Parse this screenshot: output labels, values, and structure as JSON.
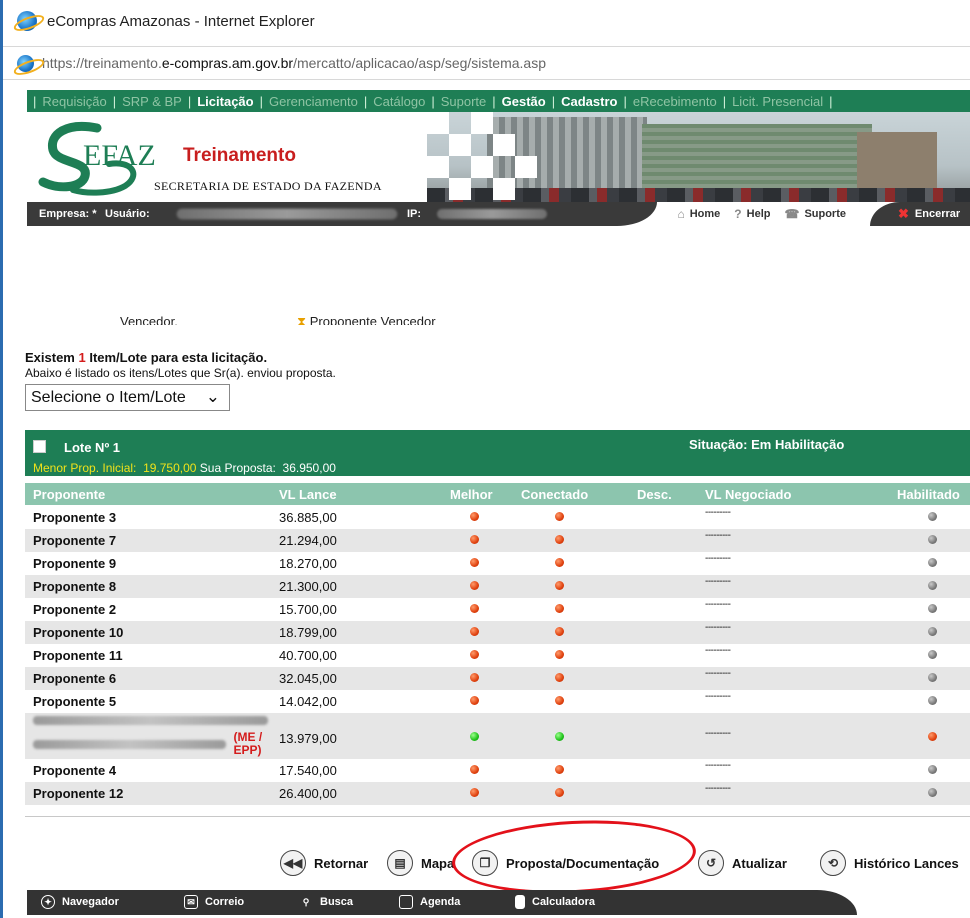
{
  "browser": {
    "title": "eCompras Amazonas - Internet Explorer",
    "url_scheme": "https://",
    "url_sub": "treinamento.",
    "url_host": "e-compras.am.gov.br",
    "url_path": "/mercatto/aplicacao/asp/seg/sistema.asp"
  },
  "topnav": {
    "items": [
      "Requisição",
      "SRP & BP",
      "Licitação",
      "Gerenciamento",
      "Catálogo",
      "Suporte",
      "Gestão",
      "Cadastro",
      "eRecebimento",
      "Licit. Presencial"
    ],
    "active": [
      false,
      false,
      true,
      false,
      false,
      false,
      true,
      true,
      false,
      false
    ]
  },
  "banner": {
    "logo_text": "EFAZ",
    "logo_s": "S",
    "title": "Treinamento",
    "subtitle": "SECRETARIA DE ESTADO DA FAZENDA"
  },
  "infobar": {
    "empresa": "Empresa: *",
    "usuario": "Usuário:",
    "ip": "IP:",
    "home": "Home",
    "help": "Help",
    "suporte": "Suporte",
    "encerrar": "Encerrar"
  },
  "legend": {
    "left": "Vencedor.",
    "right": "Proponente Vencedor"
  },
  "info": {
    "existem_pre": "Existem ",
    "count": "1",
    "existem_post": " Item/Lote para esta licitação.",
    "abaixo": "Abaixo é listado os itens/Lotes que Sr(a). enviou proposta.",
    "select": "Selecione o Item/Lote"
  },
  "lote": {
    "title": "Lote Nº 1",
    "situacao": "Situação: Em Habilitação",
    "menor_label": "Menor Prop. Inicial:",
    "menor_value": "19.750,00",
    "sua_label": "Sua Proposta:",
    "sua_value": "36.950,00"
  },
  "table": {
    "headers": [
      "Proponente",
      "VL Lance",
      "Melhor",
      "Conectado",
      "Desc.",
      "VL Negociado",
      "Habilitado"
    ],
    "rows": [
      {
        "name": "Proponente 3",
        "lance": "36.885,00",
        "melhor": "red",
        "conectado": "red",
        "negociado": "---------",
        "habilitado": "grey"
      },
      {
        "name": "Proponente 7",
        "lance": "21.294,00",
        "melhor": "red",
        "conectado": "red",
        "negociado": "---------",
        "habilitado": "grey"
      },
      {
        "name": "Proponente 9",
        "lance": "18.270,00",
        "melhor": "red",
        "conectado": "red",
        "negociado": "---------",
        "habilitado": "grey"
      },
      {
        "name": "Proponente 8",
        "lance": "21.300,00",
        "melhor": "red",
        "conectado": "red",
        "negociado": "---------",
        "habilitado": "grey"
      },
      {
        "name": "Proponente 2",
        "lance": "15.700,00",
        "melhor": "red",
        "conectado": "red",
        "negociado": "---------",
        "habilitado": "grey"
      },
      {
        "name": "Proponente 10",
        "lance": "18.799,00",
        "melhor": "red",
        "conectado": "red",
        "negociado": "---------",
        "habilitado": "grey"
      },
      {
        "name": "Proponente 11",
        "lance": "40.700,00",
        "melhor": "red",
        "conectado": "red",
        "negociado": "---------",
        "habilitado": "grey"
      },
      {
        "name": "Proponente 6",
        "lance": "32.045,00",
        "melhor": "red",
        "conectado": "red",
        "negociado": "---------",
        "habilitado": "grey"
      },
      {
        "name": "Proponente 5",
        "lance": "14.042,00",
        "melhor": "red",
        "conectado": "red",
        "negociado": "---------",
        "habilitado": "grey"
      },
      {
        "name": "",
        "tag": "(ME / EPP)",
        "lance": "13.979,00",
        "melhor": "green",
        "conectado": "green",
        "negociado": "---------",
        "habilitado": "red"
      },
      {
        "name": "Proponente 4",
        "lance": "17.540,00",
        "melhor": "red",
        "conectado": "red",
        "negociado": "---------",
        "habilitado": "grey"
      },
      {
        "name": "Proponente 12",
        "lance": "26.400,00",
        "melhor": "red",
        "conectado": "red",
        "negociado": "---------",
        "habilitado": "grey"
      }
    ]
  },
  "actions": {
    "retornar": "Retornar",
    "mapa": "Mapa",
    "proposta": "Proposta/Documentação",
    "atualizar": "Atualizar",
    "historico": "Histórico Lances"
  },
  "bottombar": {
    "navegador": "Navegador",
    "correio": "Correio",
    "busca": "Busca",
    "agenda": "Agenda",
    "calculadora": "Calculadora"
  },
  "colors": {
    "brand_green": "#1e7e55",
    "header_green": "#8cc5ae",
    "annotation_red": "#e3111a"
  }
}
